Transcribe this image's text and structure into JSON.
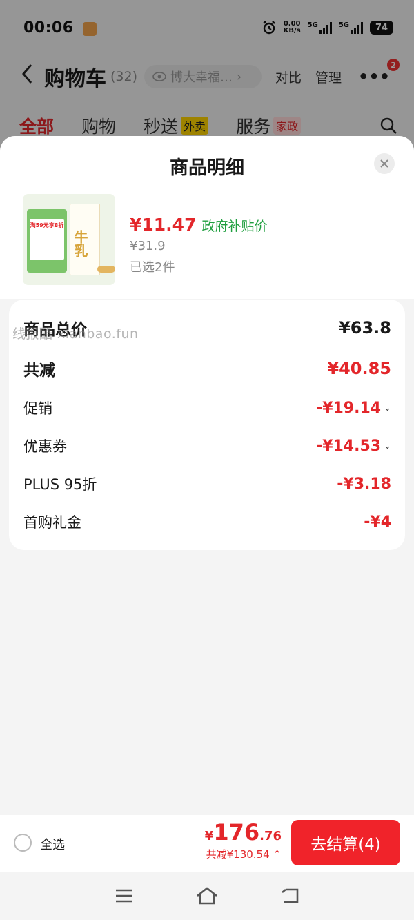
{
  "status_bar": {
    "time": "00:06",
    "net_speed_value": "0.00",
    "net_speed_unit": "KB/s",
    "signal1_label": "5G",
    "signal2_label": "5G",
    "battery": "74"
  },
  "nav": {
    "title": "购物车",
    "count": "(32)",
    "address": "博大幸福…",
    "compare": "对比",
    "manage": "管理",
    "more_badge": "2"
  },
  "tabs": [
    {
      "label": "全部",
      "tag": ""
    },
    {
      "label": "购物",
      "tag": ""
    },
    {
      "label": "秒送",
      "tag": "外卖"
    },
    {
      "label": "服务",
      "tag": "家政"
    }
  ],
  "sheet": {
    "title": "商品明细",
    "close_icon": "close-icon"
  },
  "product": {
    "image_text": "牛乳",
    "image_promo": "满59元享8折",
    "price": "¥11.47",
    "price_tag": "政府补贴价",
    "original_price": "¥31.9",
    "quantity": "已选2件"
  },
  "summary": {
    "rows": [
      {
        "label": "商品总价",
        "value": "¥63.8"
      },
      {
        "label": "共减",
        "value": "¥40.85"
      },
      {
        "label": "促销",
        "value": "-¥19.14"
      },
      {
        "label": "优惠券",
        "value": "-¥14.53"
      },
      {
        "label": "PLUS 95折",
        "value": "-¥3.18"
      },
      {
        "label": "首购礼金",
        "value": "-¥4"
      }
    ]
  },
  "watermark": "线报酷 xianbao.fun",
  "checkout": {
    "select_all": "全选",
    "currency": "¥",
    "total_int": "176",
    "total_dec": ".76",
    "total_save": "共减¥130.54",
    "button": "去结算(4)"
  },
  "colors": {
    "accent": "#e3262a",
    "green": "#1e9e3e",
    "button": "#f0232a"
  }
}
